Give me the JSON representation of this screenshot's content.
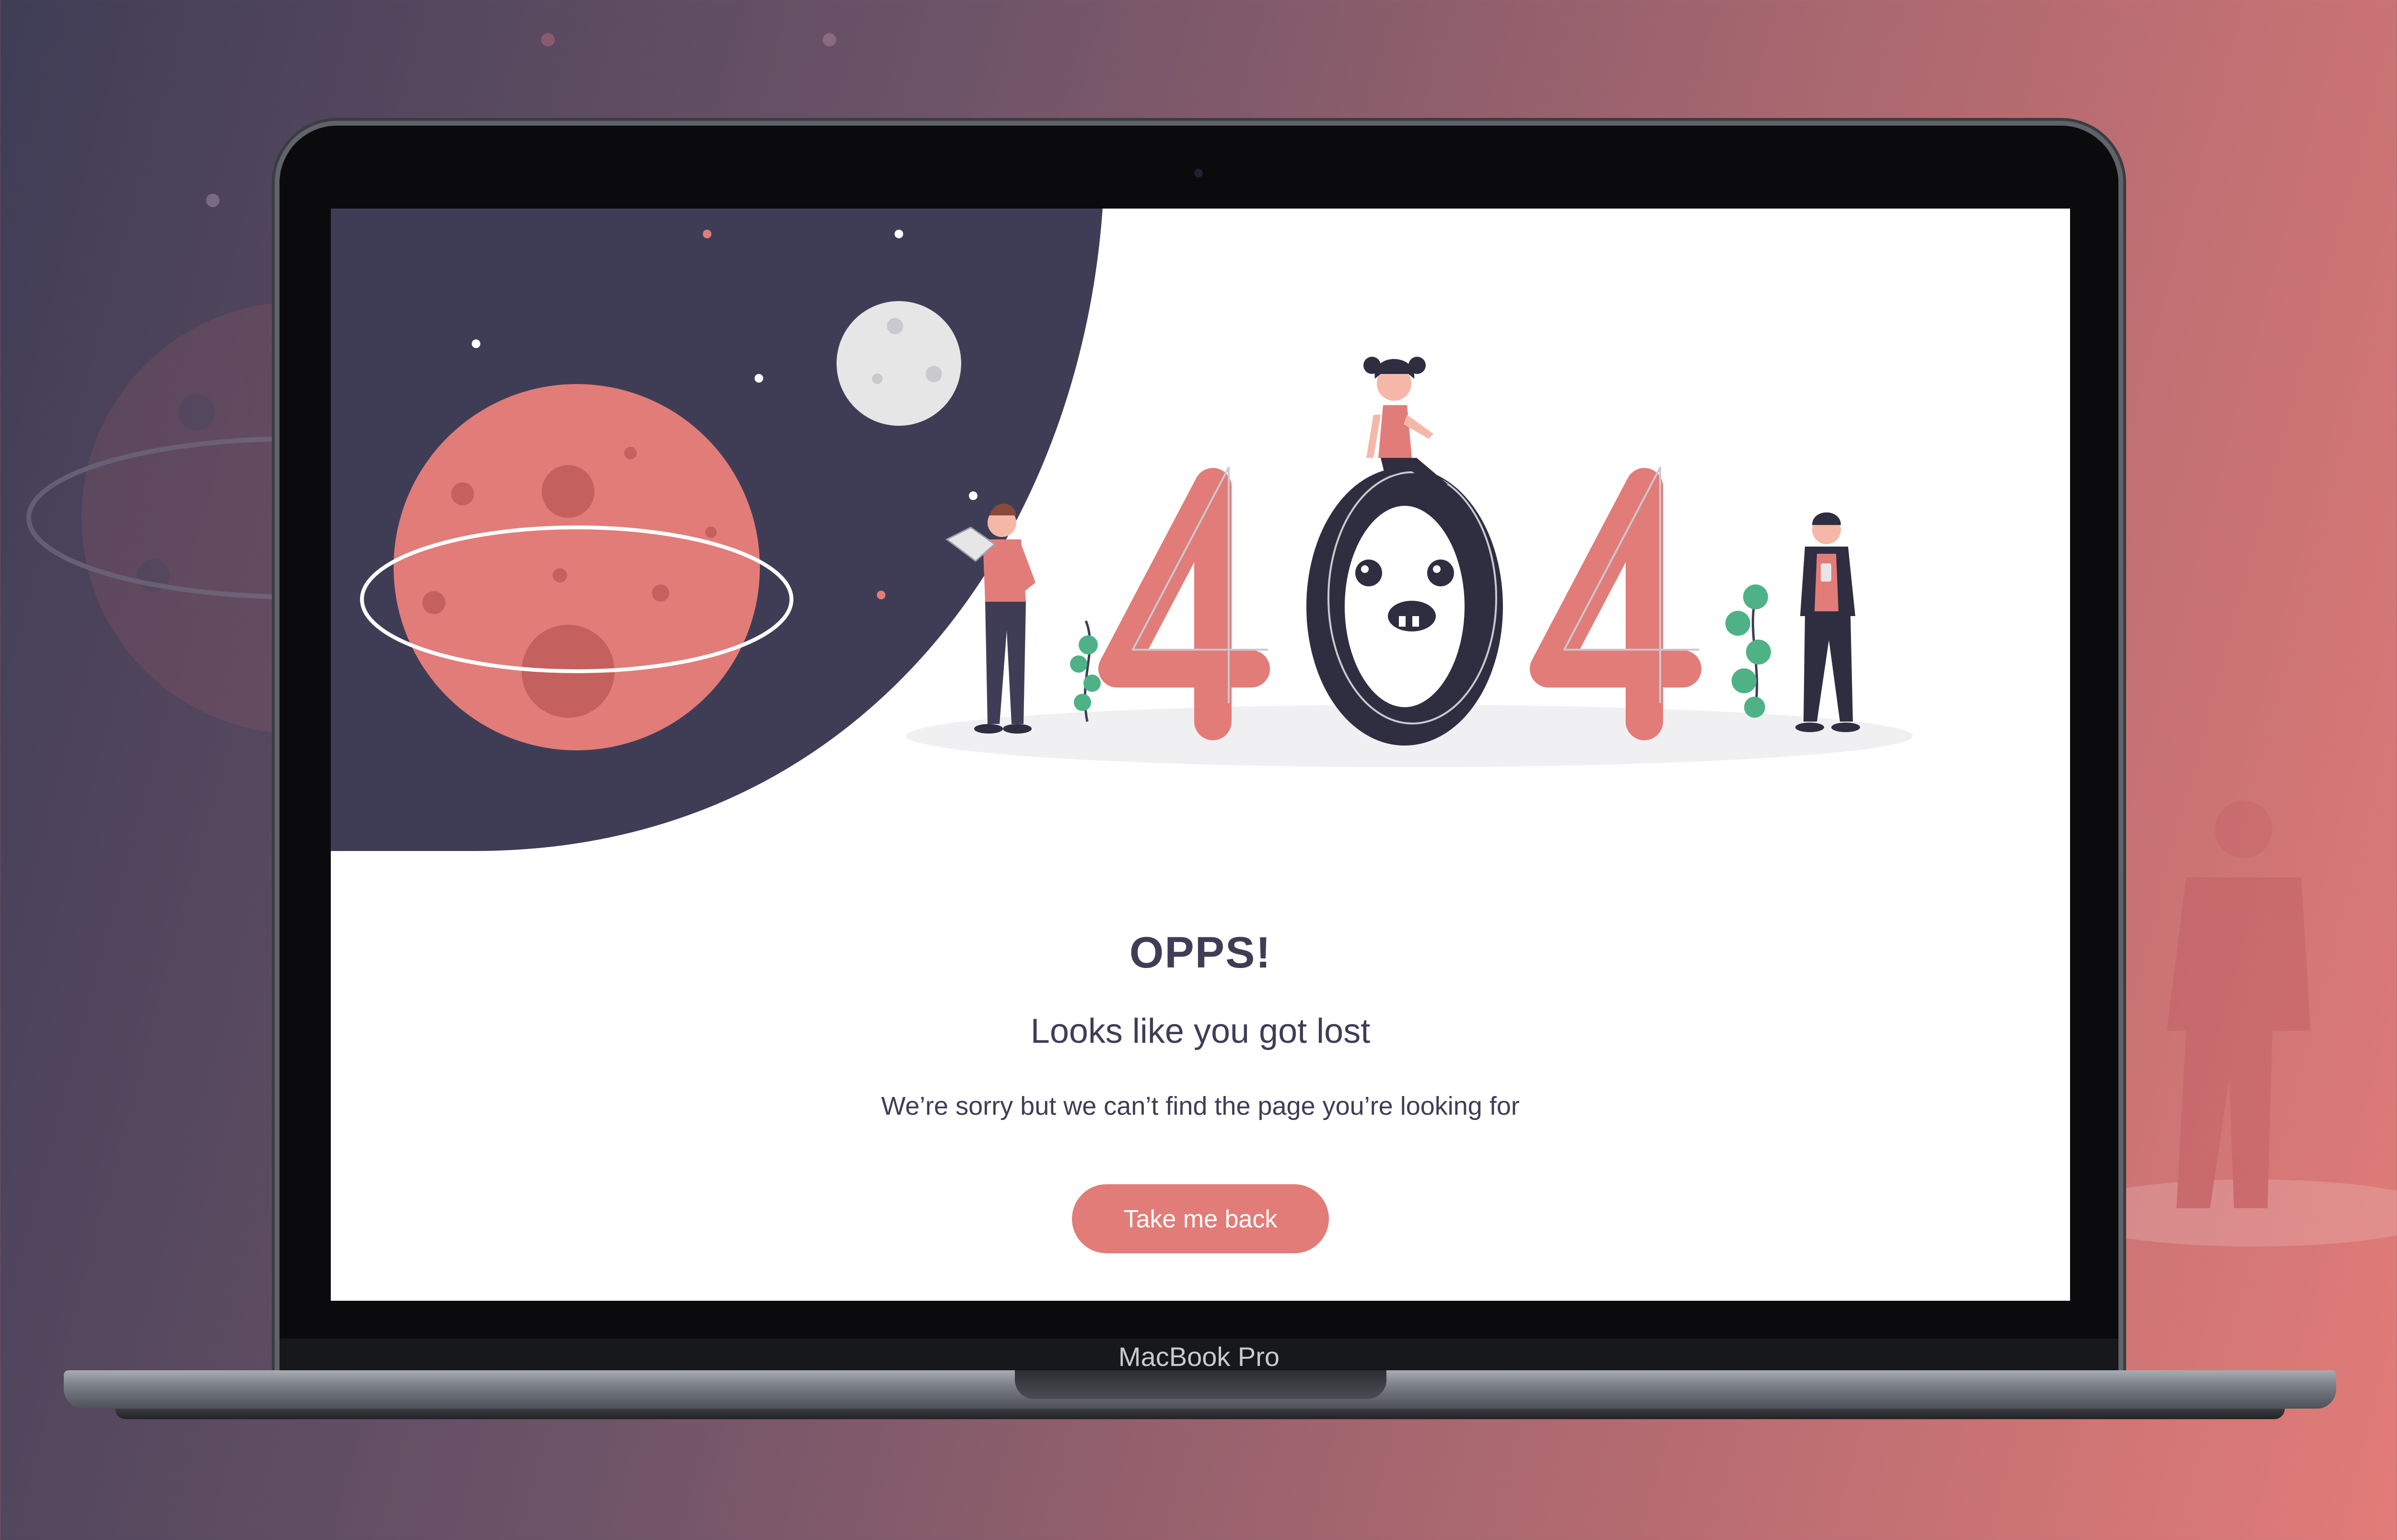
{
  "page": {
    "title": "OPPS!",
    "subtitle": "Looks like you got lost",
    "message": "We’re sorry but we can’t find the page you’re looking for",
    "button_label": "Take me back",
    "illustration_text": "404"
  },
  "device": {
    "brand_label": "MacBook Pro"
  },
  "colors": {
    "accent": "#e27c78",
    "navy": "#3f3d56",
    "background_gradient_start": "#3f3d56",
    "background_gradient_end": "#e27c78",
    "plant_green": "#4fb286",
    "moon_gray": "#e6e6e6"
  },
  "icons": [
    "planet-icon",
    "moon-icon",
    "person-with-map-icon",
    "person-sitting-icon",
    "person-with-phone-icon",
    "plant-icon",
    "star-icon"
  ]
}
